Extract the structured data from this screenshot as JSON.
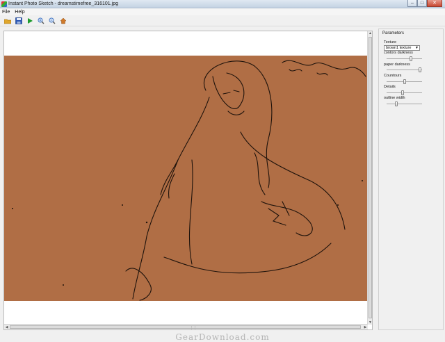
{
  "window": {
    "title": "Instant Photo Sketch - dreamstimefree_316101.jpg",
    "buttons": {
      "minimize": "–",
      "maximize": "□",
      "close": "✕"
    }
  },
  "menu": {
    "items": [
      "File",
      "Help"
    ]
  },
  "toolbar": {
    "buttons": [
      "open-icon",
      "save-icon",
      "play-icon",
      "zoom-in-icon",
      "zoom-out-icon",
      "home-icon"
    ],
    "colors": {
      "open": "#e0a72c",
      "save": "#2a57b5",
      "play": "#1f9b2e",
      "zoom": "#3a6ec0",
      "home": "#d07a2a"
    }
  },
  "canvas": {
    "photo_color": "#b06e45",
    "scroll_grip": "⋮⋮"
  },
  "parameters": {
    "title": "Parameters",
    "texture_label": "Texture",
    "texture_value": "brown1 texture",
    "sliders": [
      {
        "label": "contors darkness",
        "value": 0.7
      },
      {
        "label": "paper darkness",
        "value": 0.97
      },
      {
        "label": "Countours",
        "value": 0.5
      },
      {
        "label": "Details",
        "value": 0.45
      },
      {
        "label": "outline width",
        "value": 0.25
      }
    ]
  },
  "watermark": "GearDownload.com"
}
